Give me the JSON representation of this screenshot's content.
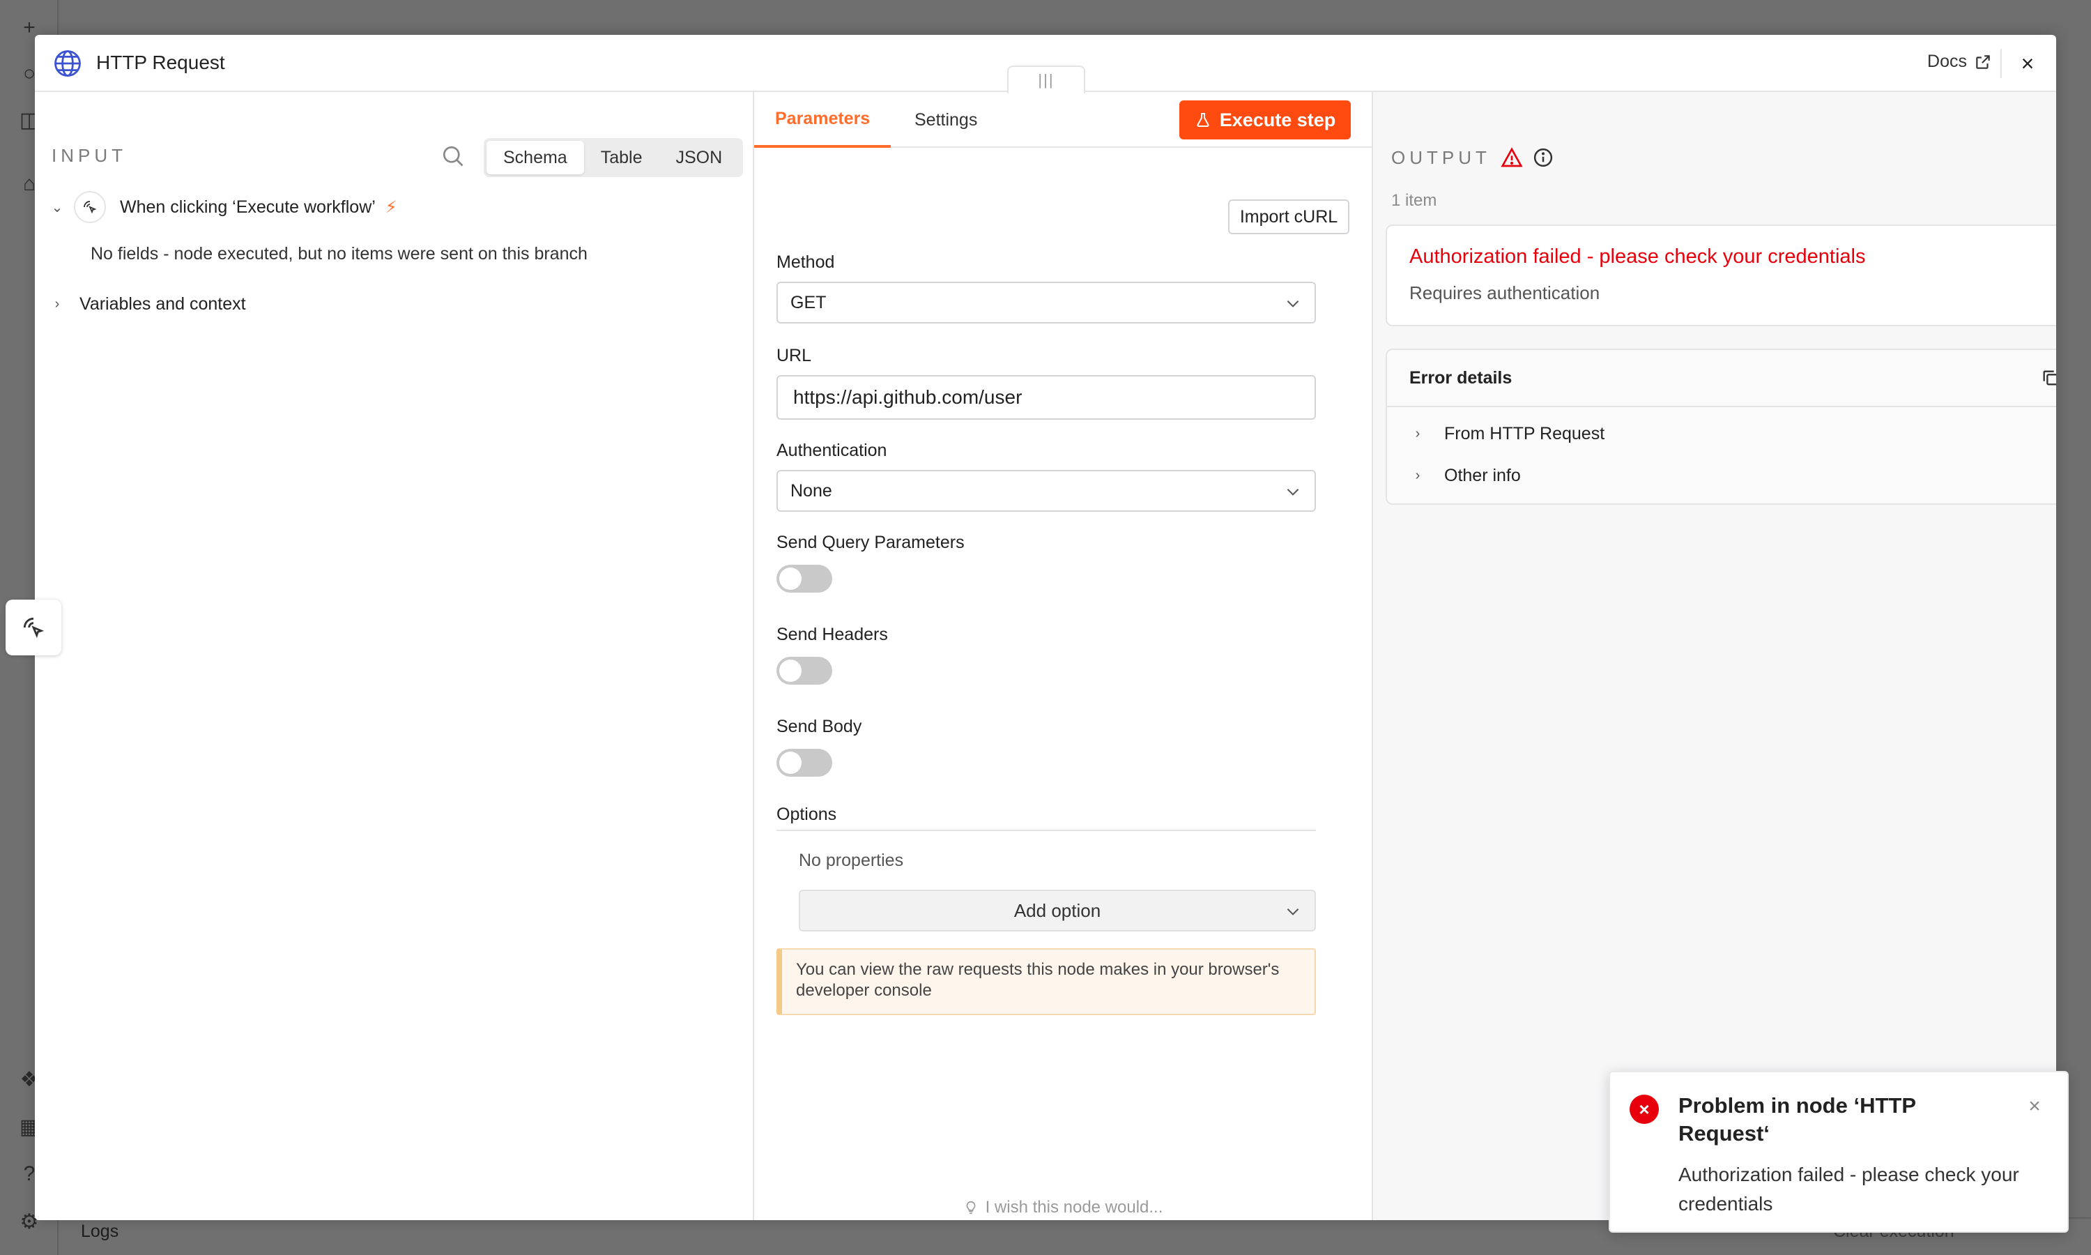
{
  "background": {
    "logs_label": "Logs",
    "clear_label": "Clear execution"
  },
  "modal": {
    "title": "HTTP Request",
    "docs_label": "Docs"
  },
  "input": {
    "label": "INPUT",
    "tabs": [
      "Schema",
      "Table",
      "JSON"
    ],
    "active_tab": "Schema",
    "trigger_node": "When clicking ‘Execute workflow’",
    "no_fields": "No fields - node executed, but no items were sent on this branch",
    "variables": "Variables and context"
  },
  "params": {
    "tabs": [
      "Parameters",
      "Settings"
    ],
    "active_tab": "Parameters",
    "execute_label": "Execute step",
    "import_label": "Import cURL",
    "method_label": "Method",
    "method_value": "GET",
    "url_label": "URL",
    "url_value": "https://api.github.com/user",
    "auth_label": "Authentication",
    "auth_value": "None",
    "send_query_label": "Send Query Parameters",
    "send_query_on": false,
    "send_headers_label": "Send Headers",
    "send_headers_on": false,
    "send_body_label": "Send Body",
    "send_body_on": false,
    "options_label": "Options",
    "no_properties": "No properties",
    "add_option": "Add option",
    "notice": "You can view the raw requests this node makes in your browser's developer console",
    "wish": "I wish this node would..."
  },
  "output": {
    "label": "OUTPUT",
    "item_count": "1 item",
    "error_title": "Authorization failed - please check your credentials",
    "error_sub": "Requires authentication",
    "details_title": "Error details",
    "details_rows": [
      "From HTTP Request",
      "Other info"
    ]
  },
  "toast": {
    "title": "Problem in node ‘HTTP Request‘",
    "message": "Authorization failed - please check your credentials"
  },
  "colors": {
    "accent": "#ff6d2d",
    "execute": "#ff4b0f",
    "error": "#e7000b"
  }
}
